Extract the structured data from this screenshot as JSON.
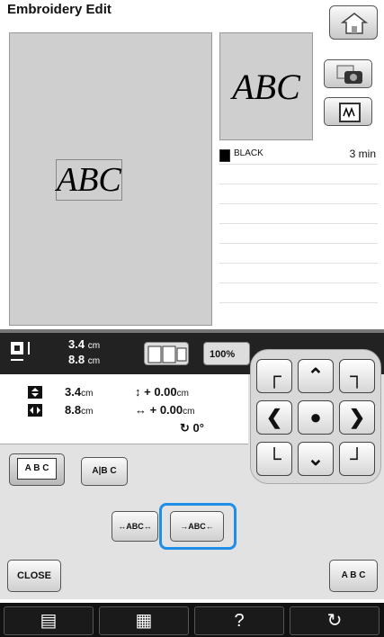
{
  "title": "Embroidery Edit",
  "preview_text": "ABC",
  "canvas_text": "ABC",
  "colors": [
    {
      "name": "BLACK",
      "time": "3 min",
      "hex": "#000000"
    }
  ],
  "info_bar": {
    "height": "3.4",
    "width": "8.8",
    "unit": "cm",
    "zoom": "100%"
  },
  "size_panel": {
    "height_value": "3.4",
    "width_value": "8.8",
    "unit": "cm",
    "offset_y": "+ 0.00",
    "offset_x": "+ 0.00",
    "rotation": "0°"
  },
  "buttons": {
    "abc_array": "A B C",
    "abc_spacing": "A|B C",
    "spacing_narrow": "↔ABC↔",
    "spacing_wide": "→ABC←",
    "close": "CLOSE",
    "abc_right": "A B C"
  },
  "bottom_icons": [
    "page-icon",
    "machine-icon",
    "help-icon",
    "settings-icon"
  ],
  "bottom_help": "?",
  "accent_color": "#1e8ee8"
}
